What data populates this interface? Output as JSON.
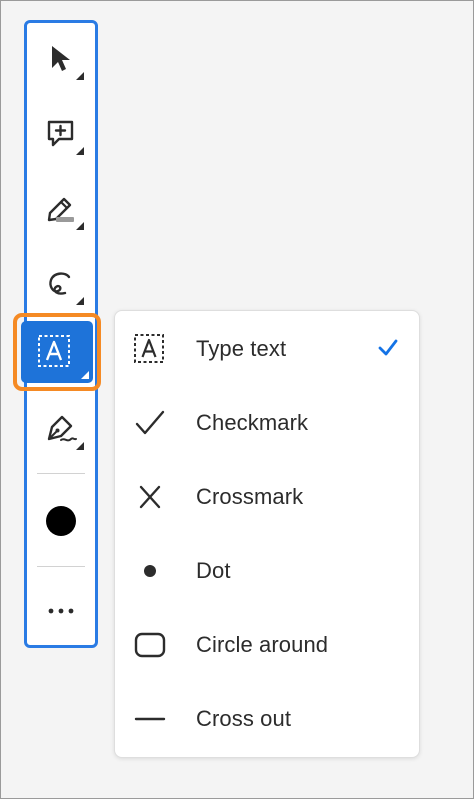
{
  "colors": {
    "accent": "#2a7be4",
    "active_tool_bg": "#1e73d9",
    "highlight": "#f58a24",
    "text": "#2c2c2c",
    "check": "#1473e6"
  },
  "toolbar": {
    "tools": [
      {
        "icon": "cursor-arrow-icon",
        "active": false
      },
      {
        "icon": "add-comment-icon",
        "active": false
      },
      {
        "icon": "highlighter-pen-icon",
        "active": false
      },
      {
        "icon": "freeform-draw-icon",
        "active": false
      },
      {
        "icon": "text-field-icon",
        "active": true
      },
      {
        "icon": "fill-sign-pen-icon",
        "active": false
      }
    ],
    "color_swatch": "#000000",
    "more_label": "..."
  },
  "menu": {
    "items": [
      {
        "label": "Type text",
        "icon": "type-text-icon",
        "selected": true
      },
      {
        "label": "Checkmark",
        "icon": "checkmark-icon",
        "selected": false
      },
      {
        "label": "Crossmark",
        "icon": "crossmark-icon",
        "selected": false
      },
      {
        "label": "Dot",
        "icon": "dot-icon",
        "selected": false
      },
      {
        "label": "Circle around",
        "icon": "circle-around-icon",
        "selected": false
      },
      {
        "label": "Cross out",
        "icon": "cross-out-icon",
        "selected": false
      }
    ]
  }
}
